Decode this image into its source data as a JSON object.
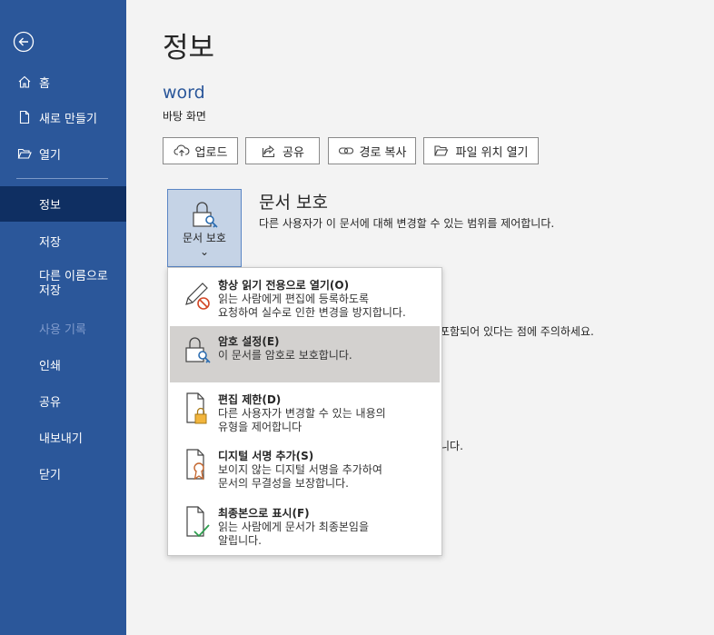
{
  "sidebar": {
    "back_icon": "back-arrow-icon",
    "items": [
      {
        "label": "홈",
        "icon": "home-icon"
      },
      {
        "label": "새로 만들기",
        "icon": "new-document-icon"
      },
      {
        "label": "열기",
        "icon": "folder-open-icon"
      },
      {
        "label": "정보"
      },
      {
        "label": "저장"
      },
      {
        "label": "다른 이름으로 저장"
      },
      {
        "label": "사용 기록"
      },
      {
        "label": "인쇄"
      },
      {
        "label": "공유"
      },
      {
        "label": "내보내기"
      },
      {
        "label": "닫기"
      }
    ]
  },
  "main": {
    "title": "정보",
    "doc_name": "word",
    "doc_location": "바탕 화면",
    "toolbar": [
      {
        "label": "업로드",
        "icon": "upload-icon"
      },
      {
        "label": "공유",
        "icon": "share-icon"
      },
      {
        "label": "경로 복사",
        "icon": "link-icon"
      },
      {
        "label": "파일 위치 열기",
        "icon": "folder-icon"
      }
    ],
    "protect_button_label": "문서 보호 ⌄",
    "protect_title": "문서 보호",
    "protect_desc": "다른 사용자가 이 문서에 대해 변경할 수 있는 범위를 제어합니다.",
    "partial_text_1": "포함되어 있다는 점에 주의하세요.",
    "partial_text_2": "니다."
  },
  "menu": {
    "items": [
      {
        "title": "항상 읽기 전용으로 열기(O)",
        "desc": "읽는 사람에게 편집에 등록하도록\n요청하여 실수로 인한 변경을 방지합니다.",
        "icon": "pencil-prohibited-icon"
      },
      {
        "title": "암호 설정(E)",
        "desc": "이 문서를 암호로 보호합니다.",
        "icon": "lock-key-icon"
      },
      {
        "title": "편집 제한(D)",
        "desc": "다른 사용자가 변경할 수 있는 내용의\n유형을 제어합니다",
        "icon": "document-lock-icon"
      },
      {
        "title": "디지털 서명 추가(S)",
        "desc": "보이지 않는 디지털 서명을 추가하여\n문서의 무결성을 보장합니다.",
        "icon": "document-ribbon-icon"
      },
      {
        "title": "최종본으로 표시(F)",
        "desc": "읽는 사람에게 문서가 최종본임을\n알립니다.",
        "icon": "document-check-icon"
      }
    ]
  },
  "colors": {
    "sidebar_bg": "#2b579a",
    "sidebar_selected": "#0f2f62",
    "accent": "#2b579a",
    "menu_highlight": "#d3d1cf"
  }
}
